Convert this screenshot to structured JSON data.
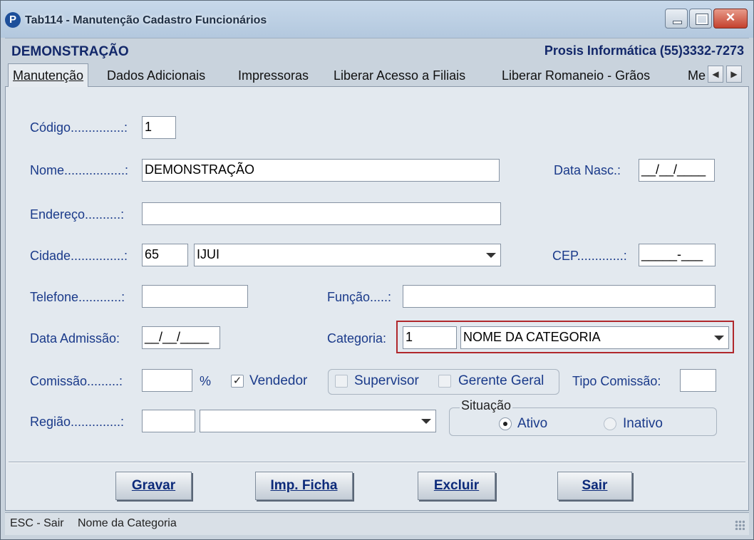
{
  "window": {
    "title": "Tab114 - Manutenção Cadastro Funcionários",
    "logo_letter": "P",
    "close_glyph": "✕"
  },
  "header": {
    "company_left": "DEMONSTRAÇÃO",
    "company_right": "Prosis Informática (55)3332-7273"
  },
  "tabs": [
    {
      "label": "Manutenção",
      "active": true
    },
    {
      "label": "Dados Adicionais"
    },
    {
      "label": "Impressoras"
    },
    {
      "label": "Liberar Acesso a Filiais"
    },
    {
      "label": "Liberar Romaneio - Grãos"
    },
    {
      "label": "Me"
    }
  ],
  "tab_scroll": {
    "left": "◀",
    "right": "▶"
  },
  "form": {
    "codigo": {
      "label": "Código...............:",
      "value": "1"
    },
    "nome": {
      "label": "Nome.................:",
      "value": "DEMONSTRAÇÃO"
    },
    "data_nasc": {
      "label": "Data Nasc.:",
      "value": "__/__/____"
    },
    "endereco": {
      "label": "Endereço..........:",
      "value": ""
    },
    "cidade": {
      "label": "Cidade...............:",
      "code": "65",
      "name": "IJUI"
    },
    "cep": {
      "label": "CEP.............:",
      "value": "_____-___"
    },
    "telefone": {
      "label": "Telefone............:",
      "value": ""
    },
    "funcao": {
      "label": "Função.....:",
      "value": ""
    },
    "data_admissao": {
      "label": "Data Admissão:",
      "value": "__/__/____"
    },
    "categoria": {
      "label": "Categoria:",
      "code": "1",
      "name": "NOME DA CATEGORIA"
    },
    "comissao": {
      "label": "Comissão.........:",
      "value": "",
      "unit": "%"
    },
    "vendedor": {
      "label": "Vendedor",
      "checked": true,
      "mark": "✓"
    },
    "supervisor": {
      "label": "Supervisor",
      "checked": false
    },
    "gerente_geral": {
      "label": "Gerente Geral",
      "checked": false
    },
    "tipo_comissao": {
      "label": "Tipo Comissão:",
      "value": ""
    },
    "regiao": {
      "label": "Região..............:",
      "code": "",
      "name": ""
    },
    "situacao": {
      "title": "Situação",
      "ativo": {
        "label": "Ativo",
        "selected": true
      },
      "inativo": {
        "label": "Inativo",
        "selected": false
      }
    }
  },
  "buttons": {
    "gravar": "Gravar",
    "imp_ficha": "Imp. Ficha",
    "excluir": "Excluir",
    "sair": "Sair"
  },
  "status": {
    "hint": "ESC - Sair",
    "field": "Nome da Categoria"
  },
  "colors": {
    "label_blue": "#1a3a8a",
    "highlight_red": "#b0282c",
    "brand_navy": "#13286a"
  }
}
